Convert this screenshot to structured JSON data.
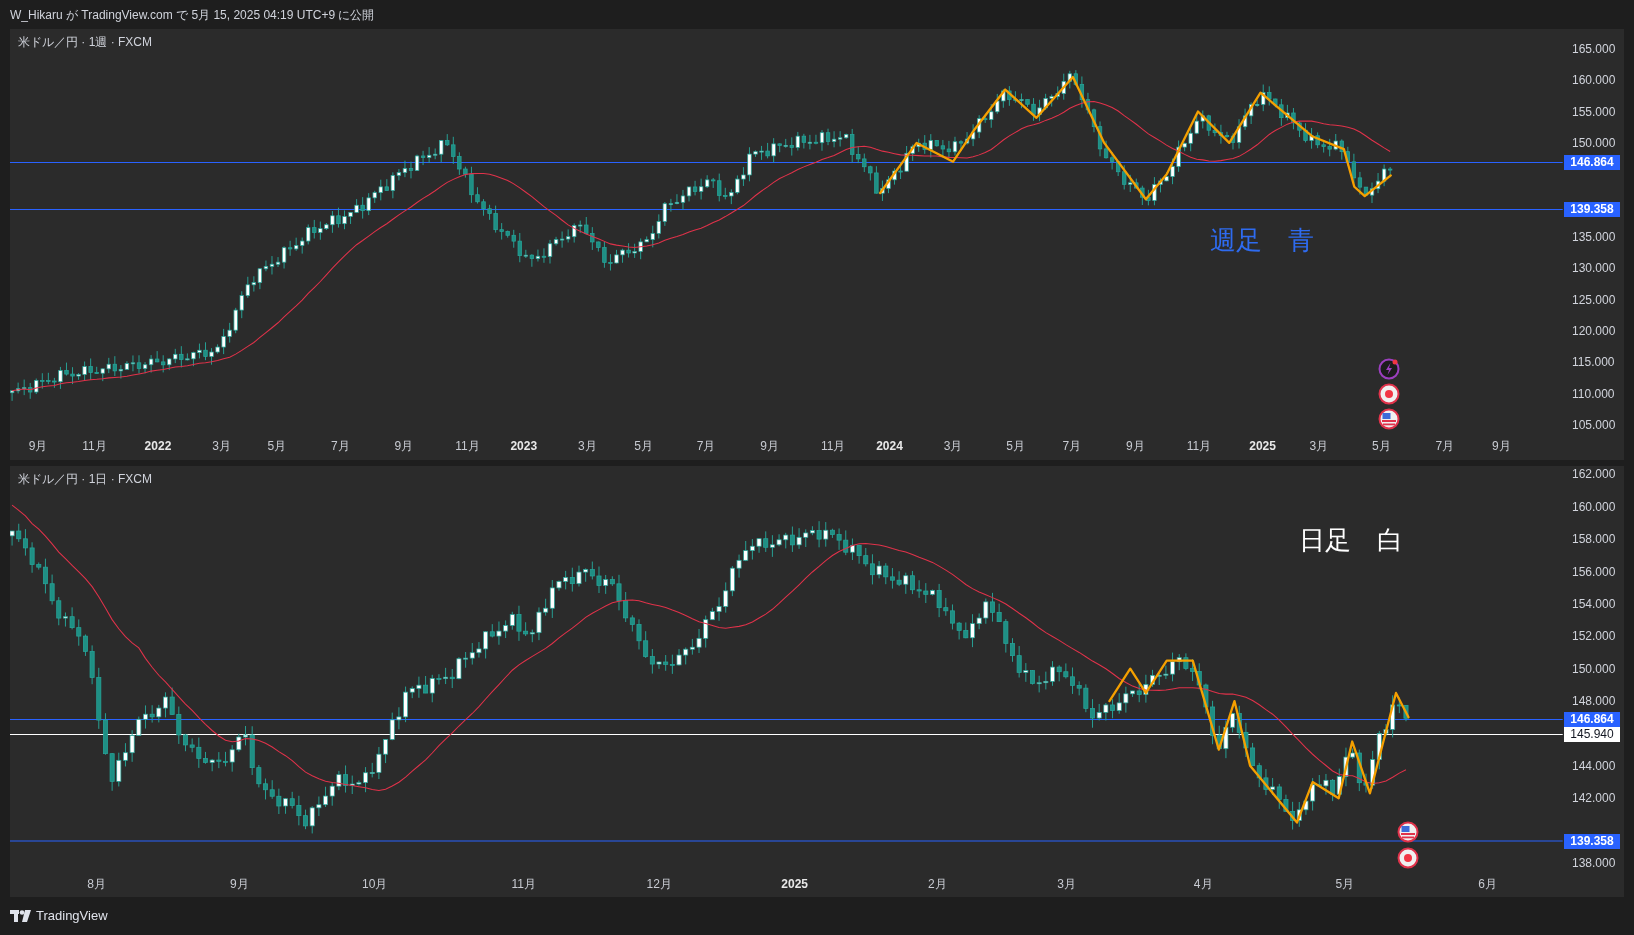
{
  "header": {
    "published": "W_Hikaru が TradingView.com で 5月 15, 2025 04:19 UTC+9 に公開"
  },
  "panels": [
    {
      "kind": "weekly",
      "symbol_title": "米ドル／円 · 1週 · FXCM",
      "note": {
        "text": "週足　青",
        "color": "#2e6bf0"
      },
      "price_axis": [
        "165.000",
        "160.000",
        "155.000",
        "150.000",
        "135.000",
        "130.000",
        "125.000",
        "120.000",
        "115.000",
        "110.000",
        "105.000"
      ],
      "time_axis": [
        {
          "text": "9月",
          "kind": "month"
        },
        {
          "text": "11月",
          "kind": "month"
        },
        {
          "text": "2022",
          "kind": "year"
        },
        {
          "text": "3月",
          "kind": "month"
        },
        {
          "text": "5月",
          "kind": "month"
        },
        {
          "text": "7月",
          "kind": "month"
        },
        {
          "text": "9月",
          "kind": "month"
        },
        {
          "text": "11月",
          "kind": "month"
        },
        {
          "text": "2023",
          "kind": "year"
        },
        {
          "text": "3月",
          "kind": "month"
        },
        {
          "text": "5月",
          "kind": "month"
        },
        {
          "text": "7月",
          "kind": "month"
        },
        {
          "text": "9月",
          "kind": "month"
        },
        {
          "text": "11月",
          "kind": "month"
        },
        {
          "text": "2024",
          "kind": "year"
        },
        {
          "text": "3月",
          "kind": "month"
        },
        {
          "text": "5月",
          "kind": "month"
        },
        {
          "text": "7月",
          "kind": "month"
        },
        {
          "text": "9月",
          "kind": "month"
        },
        {
          "text": "11月",
          "kind": "month"
        },
        {
          "text": "2025",
          "kind": "year"
        },
        {
          "text": "3月",
          "kind": "month"
        },
        {
          "text": "5月",
          "kind": "month"
        },
        {
          "text": "7月",
          "kind": "month"
        },
        {
          "text": "9月",
          "kind": "month"
        }
      ],
      "price_tags": [
        {
          "text": "146.864",
          "kind": "line"
        },
        {
          "text": "139.358",
          "kind": "line"
        }
      ]
    },
    {
      "kind": "daily",
      "symbol_title": "米ドル／円 · 1日 · FXCM",
      "note": {
        "text": "日足　白",
        "color": "#ffffff"
      },
      "price_axis": [
        "162.000",
        "160.000",
        "158.000",
        "156.000",
        "154.000",
        "152.000",
        "150.000",
        "148.000",
        "144.000",
        "142.000",
        "138.000"
      ],
      "time_axis": [
        {
          "text": "8月",
          "kind": "month"
        },
        {
          "text": "9月",
          "kind": "month"
        },
        {
          "text": "10月",
          "kind": "month"
        },
        {
          "text": "11月",
          "kind": "month"
        },
        {
          "text": "12月",
          "kind": "month"
        },
        {
          "text": "2025",
          "kind": "year"
        },
        {
          "text": "2月",
          "kind": "month"
        },
        {
          "text": "3月",
          "kind": "month"
        },
        {
          "text": "4月",
          "kind": "month"
        },
        {
          "text": "5月",
          "kind": "month"
        },
        {
          "text": "6月",
          "kind": "month"
        }
      ],
      "price_tags": [
        {
          "text": "146.864",
          "kind": "line"
        },
        {
          "text": "145.940",
          "kind": "last"
        },
        {
          "text": "139.358",
          "kind": "line"
        }
      ]
    }
  ],
  "footer": {
    "brand": "TradingView"
  }
}
